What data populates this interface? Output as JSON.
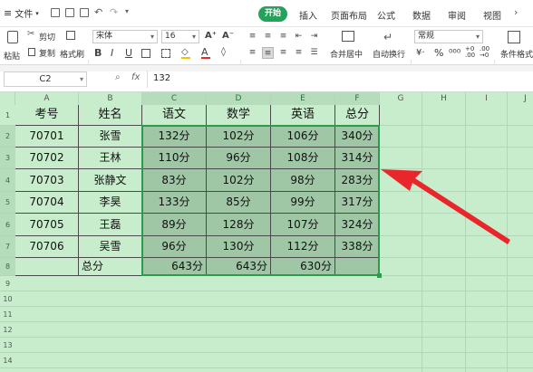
{
  "menubar": {
    "file_label": "文件",
    "tabs": [
      "开始",
      "插入",
      "页面布局",
      "公式",
      "数据",
      "审阅",
      "视图"
    ],
    "active_tab": "开始"
  },
  "ribbon": {
    "paste_label": "粘贴",
    "cut_label": "剪切",
    "copy_label": "复制",
    "format_painter_label": "格式刷",
    "font_name": "宋体",
    "font_size": "16",
    "merge_label": "合并居中",
    "wrap_label": "自动换行",
    "number_format": "常规",
    "cond_format_label": "条件格式",
    "bold": "B",
    "italic": "I",
    "underline": "U"
  },
  "formula_bar": {
    "name_box": "C2",
    "fx": "fx",
    "value": "132"
  },
  "columns": [
    "A",
    "B",
    "C",
    "D",
    "E",
    "F",
    "G",
    "H",
    "I",
    "J"
  ],
  "rows": [
    "1",
    "2",
    "3",
    "4",
    "5",
    "6",
    "7",
    "8",
    "9",
    "10",
    "11",
    "12",
    "13",
    "14"
  ],
  "table": {
    "header": [
      "考号",
      "姓名",
      "语文",
      "数学",
      "英语",
      "总分"
    ],
    "rows": [
      [
        "70701",
        "张雪",
        "132分",
        "102分",
        "106分",
        "340分"
      ],
      [
        "70702",
        "王林",
        "110分",
        "96分",
        "108分",
        "314分"
      ],
      [
        "70703",
        "张静文",
        "83分",
        "102分",
        "98分",
        "283分"
      ],
      [
        "70704",
        "李昊",
        "133分",
        "85分",
        "99分",
        "317分"
      ],
      [
        "70705",
        "王磊",
        "89分",
        "128分",
        "107分",
        "324分"
      ],
      [
        "70706",
        "吴雪",
        "96分",
        "130分",
        "112分",
        "338分"
      ]
    ],
    "total_row": [
      "",
      "总分",
      "643分",
      "643分",
      "630分",
      ""
    ]
  },
  "arrow_color": "#e8262b",
  "accent_color": "#23a35a"
}
